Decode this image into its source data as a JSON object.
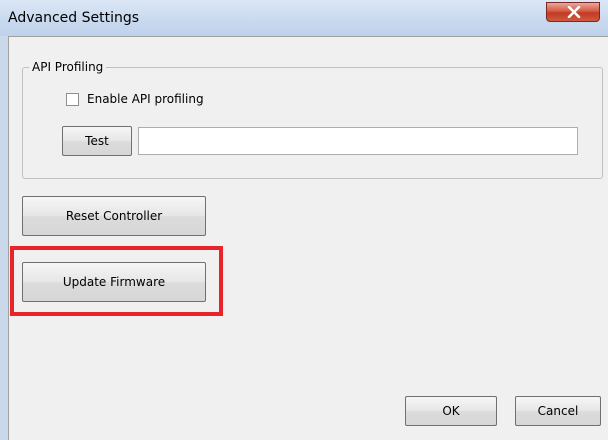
{
  "window": {
    "title": "Advanced Settings",
    "close_icon": "close-icon"
  },
  "api_profiling": {
    "group_label": "API Profiling",
    "enable_label": "Enable API profiling",
    "enable_checked": false,
    "test_label": "Test",
    "test_value": ""
  },
  "actions": {
    "reset_label": "Reset Controller",
    "update_label": "Update Firmware"
  },
  "footer": {
    "ok_label": "OK",
    "cancel_label": "Cancel"
  },
  "colors": {
    "highlight": "#e8232a",
    "close_button": "#c23a24",
    "frame": "#c9d8ea",
    "dialog": "#f0f0f0"
  }
}
